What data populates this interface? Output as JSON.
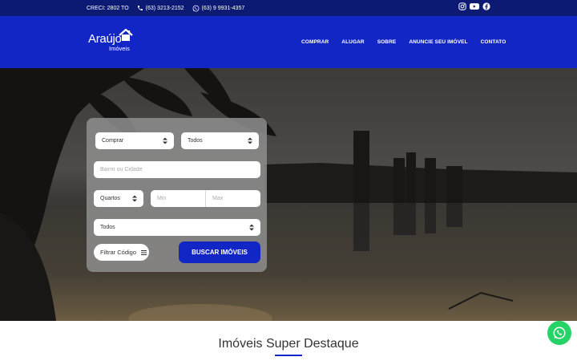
{
  "topbar": {
    "creci": "CRECI: 2802 TO",
    "phone": "(63) 3213-2152",
    "whatsapp": "(63) 9 9931-4357",
    "social": [
      "instagram-icon",
      "youtube-icon",
      "facebook-icon"
    ]
  },
  "brand": {
    "name": "Araújo",
    "subtitle": "Imóveis"
  },
  "nav": [
    "COMPRAR",
    "ALUGAR",
    "SOBRE",
    "ANUNCIE SEU IMÓVEL",
    "CONTATO"
  ],
  "search": {
    "transaction": "Comprar",
    "type": "Todos",
    "location_placeholder": "Bairro ou Cidade",
    "rooms": "Quartos",
    "min_placeholder": "Min",
    "max_placeholder": "Max",
    "category": "Todos",
    "filter_label": "Filtrar Código",
    "submit_label": "BUSCAR IMÓVEIS"
  },
  "section": {
    "title": "Imóveis Super Destaque"
  },
  "colors": {
    "topbar": "#0d1a73",
    "header": "#1226c6",
    "accent": "#1226c6",
    "whatsapp": "#25d366"
  }
}
